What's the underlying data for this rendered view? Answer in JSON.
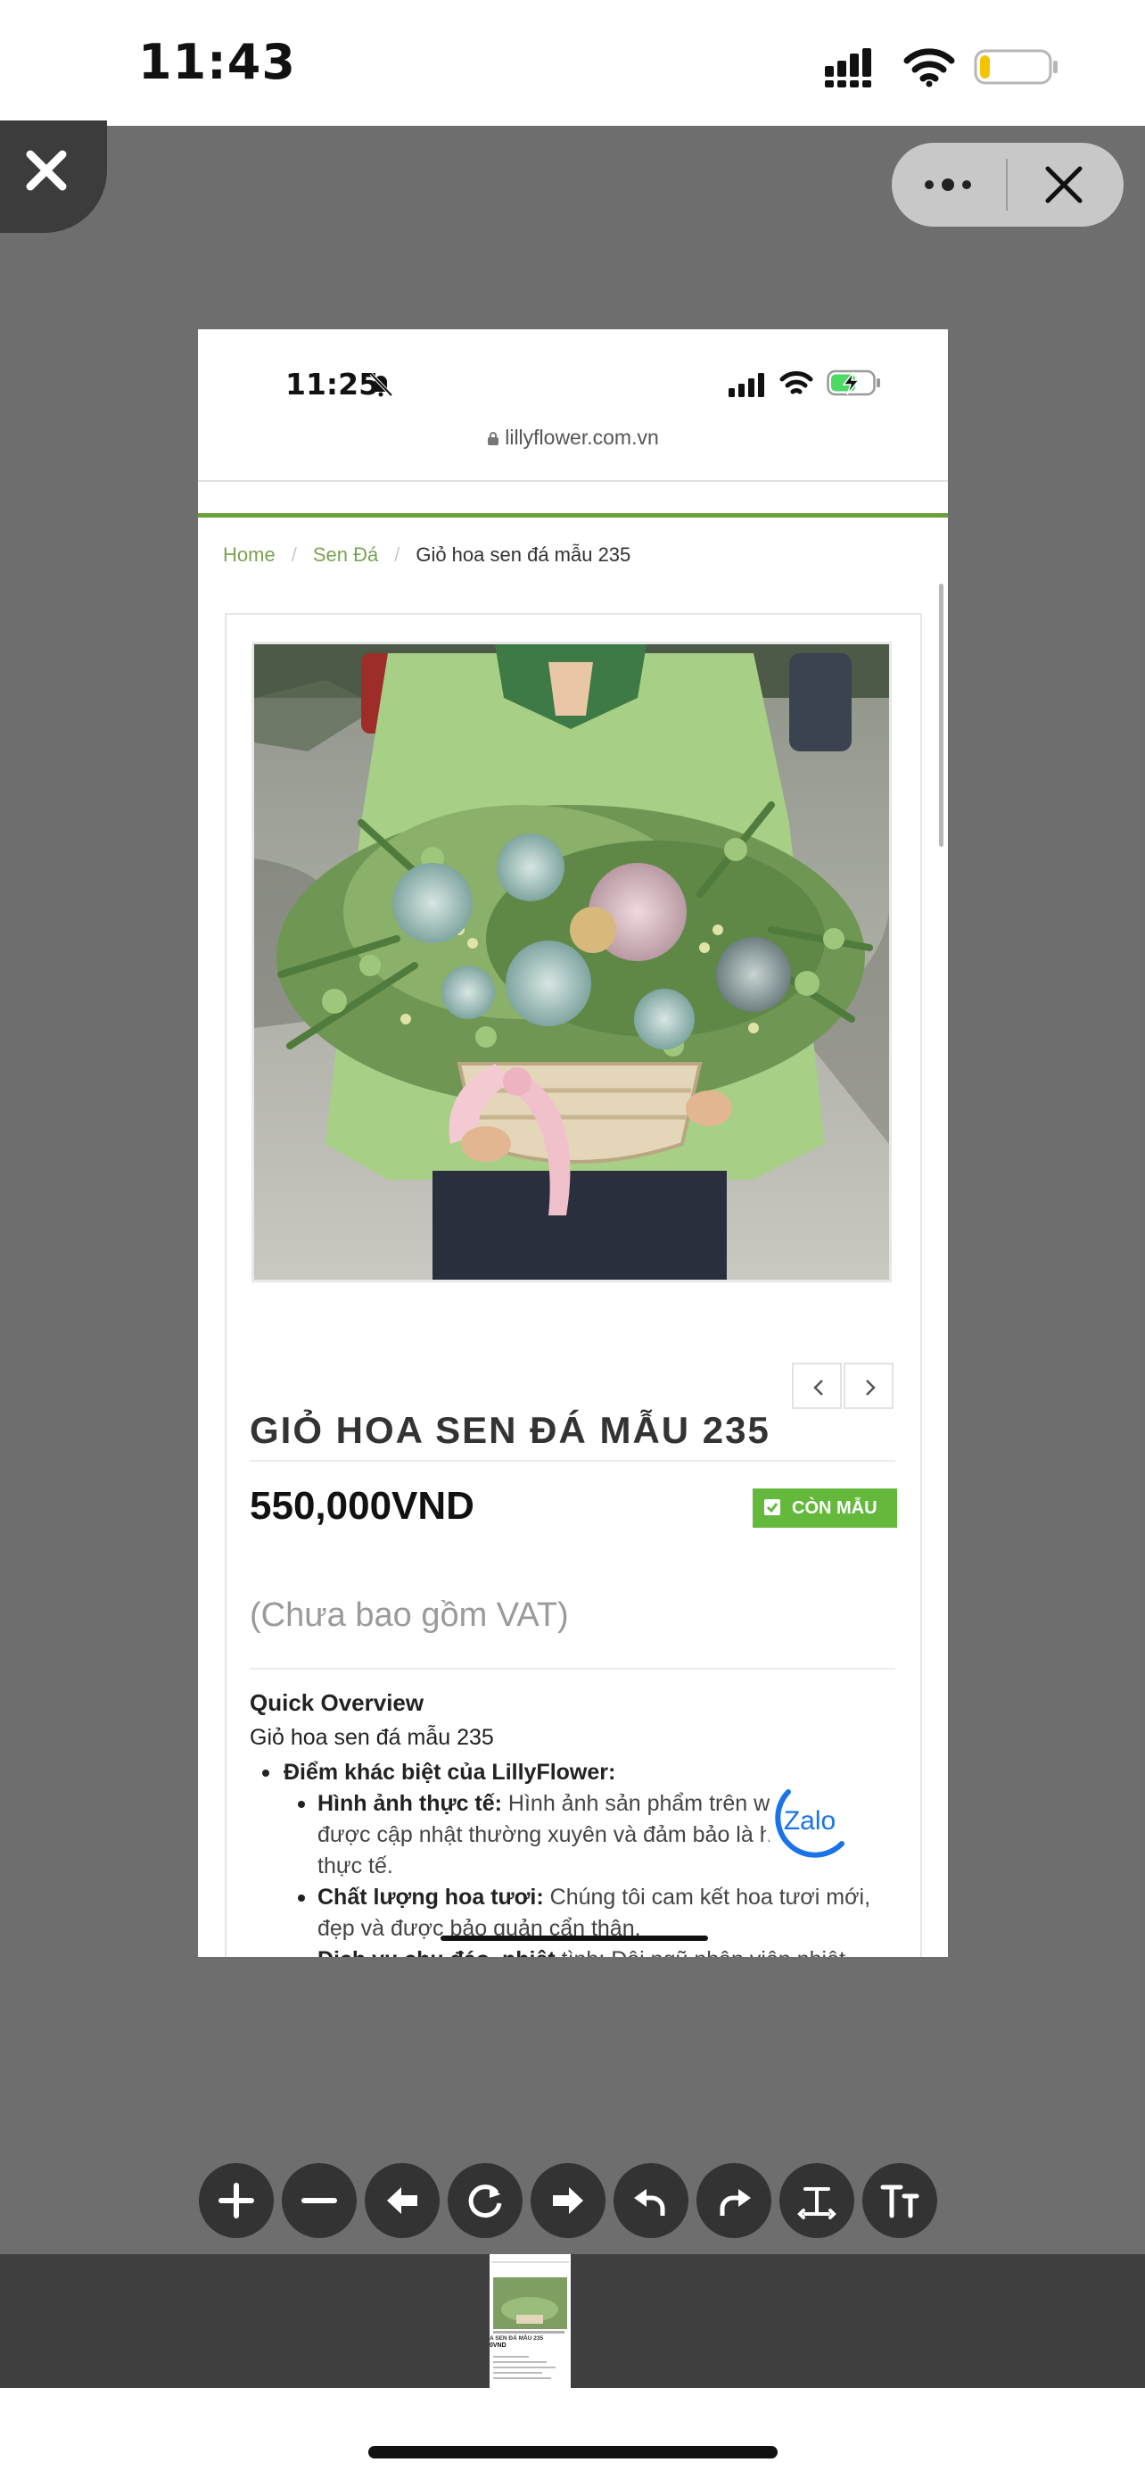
{
  "outer_status": {
    "time": "11:43",
    "battery_level": 0.15,
    "battery_color": "#f5c400"
  },
  "viewer": {
    "background_color": "#6e6e6e",
    "corner_close_icon": "close-icon",
    "menu_icon": "more-dots-icon",
    "close_icon": "close-icon"
  },
  "document": {
    "inner_status": {
      "time": "11:25",
      "battery_level": 0.6,
      "charging": true,
      "battery_color": "#4cd964"
    },
    "url": "lillyflower.com.vn",
    "accent_color": "#6aa13d",
    "breadcrumb": {
      "home": "Home",
      "category": "Sen Đá",
      "current": "Giỏ hoa sen đá mẫu 235",
      "separator": "/"
    },
    "product": {
      "title": "GIỎ HOA SEN ĐÁ MẪU 235",
      "price": "550,000VND",
      "stock_badge": "CÒN MẪU",
      "vat_note": "(Chưa bao gồm VAT)"
    },
    "overview": {
      "heading": "Quick Overview",
      "name": "Giỏ hoa sen đá mẫu 235",
      "highlight_title": "Điểm khác biệt của LillyFlower:",
      "items": [
        {
          "bold": "Hình ảnh thực tế:",
          "text": " Hình ảnh sản phẩm trên website được cập nhật thường xuyên và đảm bảo là hình ảnh thực tế."
        },
        {
          "bold": "Chất lượng hoa tươi:",
          "text": " Chúng tôi cam kết hoa tươi mới, đẹp và được bảo quản cẩn thận."
        },
        {
          "bold": "Dịch vụ chu đáo, nhiệt",
          "text": " tình: Đội ngũ nhân viên nhiệt tình"
        }
      ]
    },
    "zalo_label": "Zalo"
  },
  "toolbar": {
    "buttons": [
      "zoom-in-icon",
      "zoom-out-icon",
      "arrow-left-icon",
      "rotate-icon",
      "arrow-right-icon",
      "undo-icon",
      "redo-icon",
      "text-tool-icon",
      "text-size-icon"
    ]
  },
  "thumbnail": {
    "title": "A SEN ĐÁ MẪU 235",
    "price": "0VND"
  }
}
